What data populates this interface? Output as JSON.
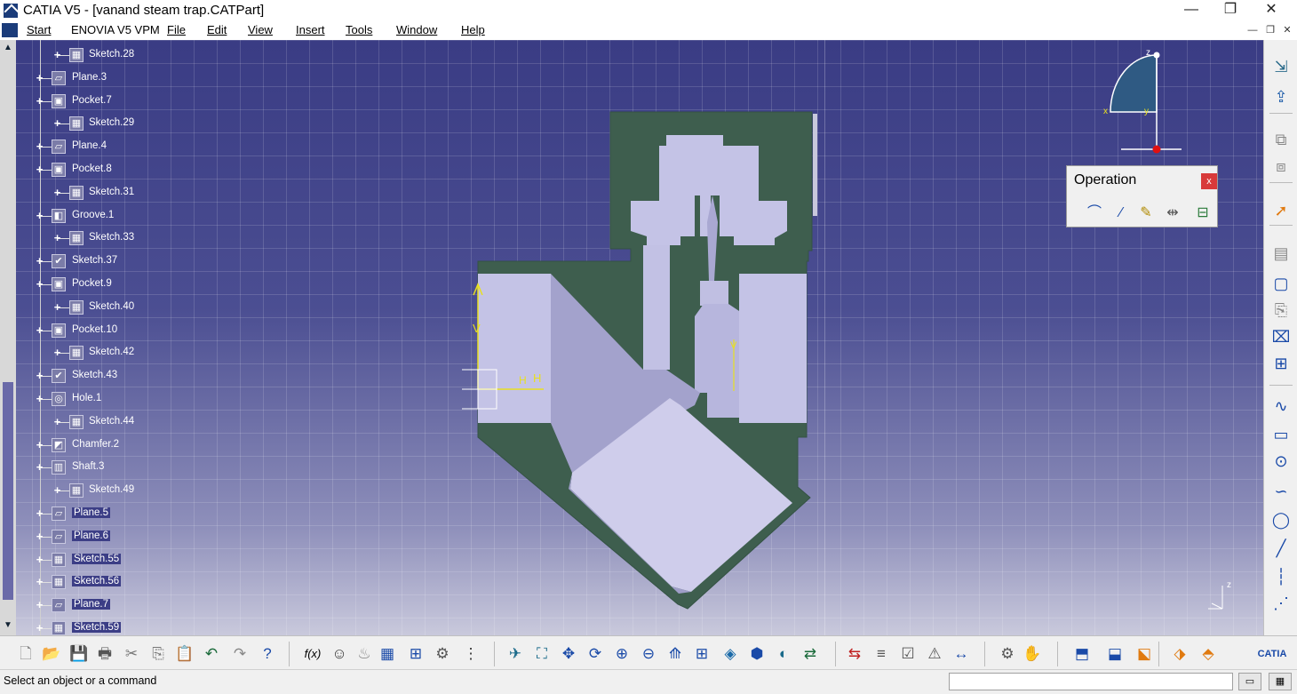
{
  "window": {
    "title": "CATIA V5 - [vanand steam trap.CATPart]",
    "minimize": "—",
    "restore": "❐",
    "close": "✕"
  },
  "menu": {
    "items": [
      "Start",
      "ENOVIA V5 VPM",
      "File",
      "Edit",
      "View",
      "Insert",
      "Tools",
      "Window",
      "Help"
    ],
    "doc_controls": [
      "—",
      "❐",
      "✕"
    ]
  },
  "tree": {
    "items": [
      {
        "label": "Sketch.28",
        "icon": "sketch-icon",
        "level": 2
      },
      {
        "label": "Plane.3",
        "icon": "plane-icon",
        "level": 1
      },
      {
        "label": "Pocket.7",
        "icon": "pocket-icon",
        "level": 1
      },
      {
        "label": "Sketch.29",
        "icon": "sketch-icon",
        "level": 2
      },
      {
        "label": "Plane.4",
        "icon": "plane-icon",
        "level": 1
      },
      {
        "label": "Pocket.8",
        "icon": "pocket-icon",
        "level": 1
      },
      {
        "label": "Sketch.31",
        "icon": "sketch-icon",
        "level": 2
      },
      {
        "label": "Groove.1",
        "icon": "groove-icon",
        "level": 1
      },
      {
        "label": "Sketch.33",
        "icon": "sketch-icon",
        "level": 2
      },
      {
        "label": "Sketch.37",
        "icon": "sketch-check-icon",
        "level": 1
      },
      {
        "label": "Pocket.9",
        "icon": "pocket-icon",
        "level": 1
      },
      {
        "label": "Sketch.40",
        "icon": "sketch-icon",
        "level": 2
      },
      {
        "label": "Pocket.10",
        "icon": "pocket-icon",
        "level": 1
      },
      {
        "label": "Sketch.42",
        "icon": "sketch-icon",
        "level": 2
      },
      {
        "label": "Sketch.43",
        "icon": "sketch-check-icon",
        "level": 1
      },
      {
        "label": "Hole.1",
        "icon": "hole-icon",
        "level": 1
      },
      {
        "label": "Sketch.44",
        "icon": "sketch-icon",
        "level": 2
      },
      {
        "label": "Chamfer.2",
        "icon": "chamfer-icon",
        "level": 1
      },
      {
        "label": "Shaft.3",
        "icon": "shaft-icon",
        "level": 1
      },
      {
        "label": "Sketch.49",
        "icon": "sketch-icon",
        "level": 2
      },
      {
        "label": "Plane.5",
        "icon": "plane-icon",
        "level": 1
      },
      {
        "label": "Plane.6",
        "icon": "plane-icon",
        "level": 1
      },
      {
        "label": "Sketch.55",
        "icon": "sketch-icon",
        "level": 1
      },
      {
        "label": "Sketch.56",
        "icon": "sketch-icon",
        "level": 1
      },
      {
        "label": "Plane.7",
        "icon": "plane-icon",
        "level": 1
      },
      {
        "label": "Sketch.59",
        "icon": "sketch-icon",
        "level": 1
      }
    ]
  },
  "viewport": {
    "axis_h": "H",
    "axis_v": "V",
    "compass_z": "z",
    "compass_x": "x",
    "compass_y": "y",
    "mini_axis_z": "z"
  },
  "operation_toolbar": {
    "title": "Operation",
    "close": "x",
    "tools": [
      "corner-icon",
      "chamfer-line-icon",
      "trim-eraser-icon",
      "mirror-icon",
      "project-3d-icon"
    ]
  },
  "right_toolbar": {
    "tools": [
      "exit-sketch-icon",
      "export-icon",
      "copy-props-icon",
      "paste-props-icon",
      "select-arrow-icon",
      "grid-icon",
      "snap-icon",
      "construction-icon",
      "constraint-icon",
      "auto-constraint-icon",
      "profile-icon",
      "rectangle-icon",
      "circle-center-icon",
      "spline-icon",
      "circle-icon",
      "line-icon",
      "axis-icon",
      "point-icon"
    ]
  },
  "bottom_toolbar": {
    "tools": [
      "new-icon",
      "open-icon",
      "save-icon",
      "print-icon",
      "cut-icon",
      "copy-icon",
      "paste-icon",
      "undo-icon",
      "redo-icon",
      "whats-this-icon",
      "formula-icon",
      "knowledge-icon",
      "tools-icon",
      "table-icon",
      "catalog-icon",
      "macro-icon",
      "spec-icon",
      "fly-icon",
      "fit-all-icon",
      "pan-icon",
      "rotate-icon",
      "zoom-in-icon",
      "zoom-out-icon",
      "normal-view-icon",
      "multi-view-icon",
      "iso-view-icon",
      "shading-icon",
      "hide-show-icon",
      "swap-space-icon",
      "constraint-analysis-icon",
      "geometry-list-icon",
      "check-icon",
      "sketch-solving-icon",
      "measure-icon",
      "material-icon",
      "hand-icon",
      "sketch-plane-icon",
      "sketch-positioned-icon",
      "publish-icon",
      "explode-icon",
      "hybrid-icon",
      "catia-logo"
    ]
  },
  "status": {
    "text": "Select an object or a command",
    "input_value": "",
    "btn1": "▭",
    "btn2": "▦"
  },
  "colors": {
    "viewport_top": "#3a3c84",
    "viewport_bottom": "#c9c9dc",
    "part_section": "#3e5e4e",
    "part_body": "#b9b8dc",
    "sketch_axis": "#e8e020"
  }
}
